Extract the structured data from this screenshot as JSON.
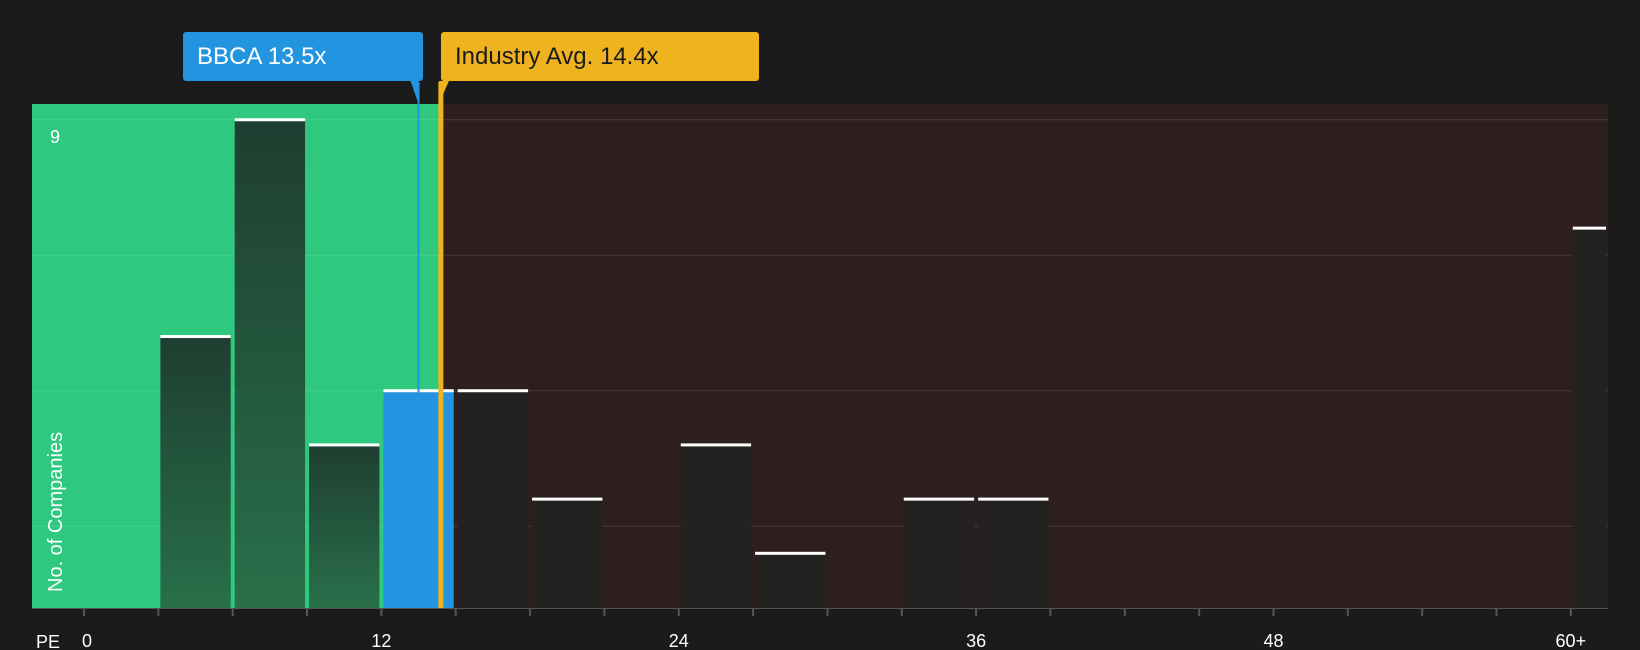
{
  "chart_data": {
    "type": "bar",
    "title": "",
    "xlabel": "PE",
    "ylabel": "No. of Companies",
    "bins": [
      {
        "x0": 0,
        "x1": 3,
        "count": 0
      },
      {
        "x0": 3,
        "x1": 6,
        "count": 5
      },
      {
        "x0": 6,
        "x1": 9,
        "count": 9
      },
      {
        "x0": 9,
        "x1": 12,
        "count": 3
      },
      {
        "x0": 12,
        "x1": 15,
        "count": 4
      },
      {
        "x0": 15,
        "x1": 18,
        "count": 4
      },
      {
        "x0": 18,
        "x1": 21,
        "count": 2
      },
      {
        "x0": 21,
        "x1": 24,
        "count": 0
      },
      {
        "x0": 24,
        "x1": 27,
        "count": 3
      },
      {
        "x0": 27,
        "x1": 30,
        "count": 1
      },
      {
        "x0": 30,
        "x1": 33,
        "count": 0
      },
      {
        "x0": 33,
        "x1": 36,
        "count": 2
      },
      {
        "x0": 36,
        "x1": 39,
        "count": 2
      },
      {
        "x0": 39,
        "x1": 60,
        "count": 0
      },
      {
        "x0": 60,
        "x1": 61.5,
        "count": 7
      }
    ],
    "highlight_bin_x0": 12,
    "x_ticks": [
      0,
      3,
      6,
      9,
      12,
      15,
      18,
      21,
      24,
      27,
      30,
      33,
      36,
      39,
      42,
      45,
      48,
      51,
      54,
      57,
      60
    ],
    "x_tick_labels": [
      {
        "value": 0,
        "label": "0"
      },
      {
        "value": 12,
        "label": "12"
      },
      {
        "value": 24,
        "label": "24"
      },
      {
        "value": 36,
        "label": "36"
      },
      {
        "value": 48,
        "label": "48"
      },
      {
        "value": 60,
        "label": "60+"
      }
    ],
    "y_tick_label": "9",
    "ylim": [
      0,
      9.3
    ],
    "xlim": [
      -2.1,
      61.5
    ],
    "grid": true,
    "company": {
      "ticker": "BBCA",
      "value": 13.5,
      "label": "BBCA 13.5x"
    },
    "industry": {
      "value": 14.4,
      "label": "Industry Avg. 14.4x"
    },
    "colors": {
      "background": "#1b1b1b",
      "undervalued_zone": "#2ec97f",
      "overvalued_zone": "#2e1f1f",
      "bar_in_green": "#1f4a36",
      "bar_in_red": "#242121",
      "highlight_bar": "#2394e0",
      "industry_line": "#efb31f",
      "company_line": "#2394e0",
      "cap": "#ffffff",
      "text": "#ffffff"
    }
  }
}
